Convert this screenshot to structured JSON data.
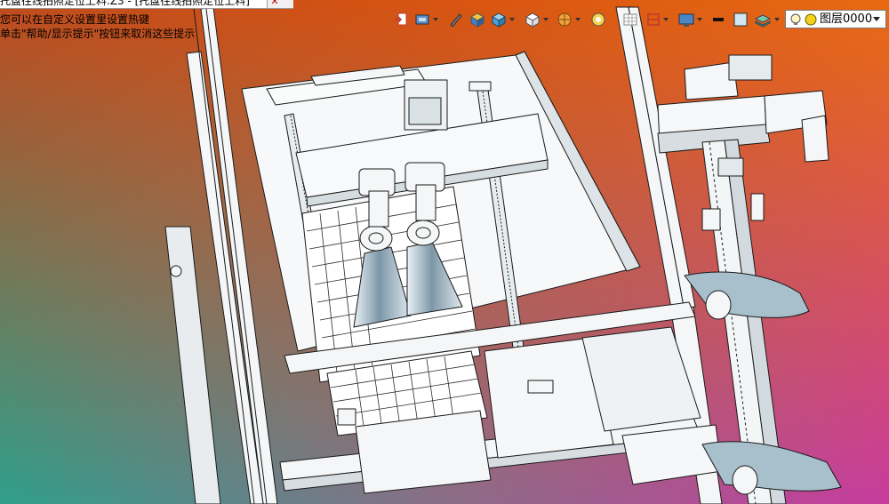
{
  "document_tab": {
    "title": "托盘往线拍照定位上料.Z3 - [托盘往线拍照定位上料]"
  },
  "hints": {
    "line1": "您可以在自定义设置里设置热键",
    "line2": "单击\"帮助/显示提示\"按钮来取消这些提示"
  },
  "layer_selector": {
    "value": "图层0000"
  },
  "toolbar_icons": [
    "exit-sketch-icon",
    "view-orientation-icon",
    "pen-icon",
    "shaded-box-icon",
    "display-style-icon",
    "standard-view-icon",
    "render-mode-icon",
    "lighting-icon",
    "grid-icon",
    "section-view-icon",
    "monitor-icon",
    "line-color-icon",
    "fill-color-icon",
    "layer-manager-icon",
    "bulb-icon",
    "layer-status-icon"
  ],
  "colors": {
    "background_top_left": "#c9501a",
    "background_top_right": "#e8660f",
    "background_bottom_left": "#3aa08a",
    "background_bottom_right": "#c43ca0",
    "model_face": "#f4f6f7",
    "model_edge": "#1a1a1a",
    "model_shade": "#8fa6b4"
  }
}
